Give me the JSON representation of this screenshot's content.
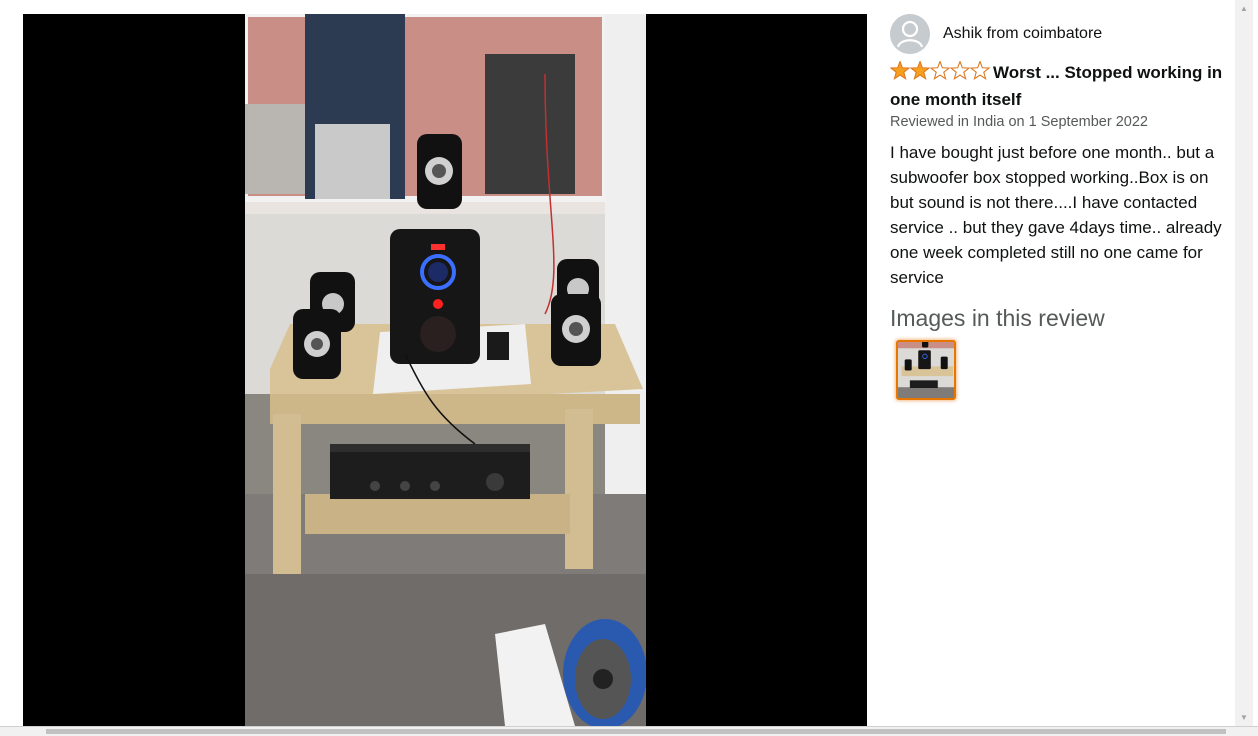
{
  "review": {
    "author": "Ashik from coimbatore",
    "rating": 2,
    "max_rating": 5,
    "title": "Worst ... Stopped working in one month itself",
    "date": "Reviewed in India on 1 September 2022",
    "body": "I have bought just before one month.. but a subwoofer box stopped working..Box is on but sound is not there....I have contacted service .. but they gave 4days time.. already one week completed still no one came for service"
  },
  "images_section": {
    "heading": "Images in this review"
  },
  "colors": {
    "star_fill": "#f7a01e",
    "star_outline": "#de7921",
    "thumb_border": "#e77600",
    "viewer_background": "#000000"
  },
  "icons": {
    "avatar": "default-user-avatar-icon",
    "scroll_up": "triangle-up-icon",
    "scroll_down": "triangle-down-icon"
  }
}
